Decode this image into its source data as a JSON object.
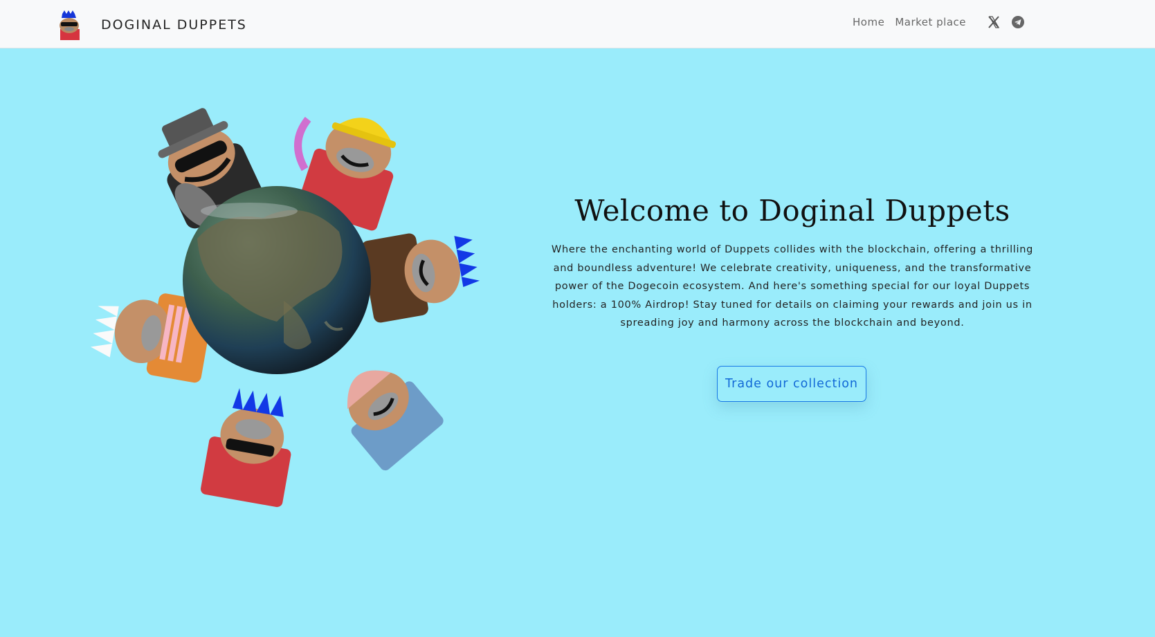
{
  "navbar": {
    "brand_name": "DOGINAL DUPPETS",
    "logo_icon": "duppet-logo-icon",
    "links": [
      {
        "label": "Home"
      },
      {
        "label": "Market place"
      }
    ],
    "icons": [
      "x-twitter-icon",
      "telegram-icon"
    ]
  },
  "hero": {
    "title": "Welcome to Doginal Duppets",
    "text": "Where the enchanting world of Duppets collides with the blockchain, offering a thrilling and boundless adventure! We celebrate creativity, uniqueness, and the transformative power of the Dogecoin ecosystem. And here's something special for our loyal Duppets holders: a 100% Airdrop! Stay tuned for details on claiming your rewards and join us in spreading joy and harmony across the blockchain and beyond.",
    "button_label": "Trade our collection"
  },
  "colors": {
    "background": "#9aecfb",
    "navbar": "#f8f9fa",
    "accent": "#1677e6"
  }
}
